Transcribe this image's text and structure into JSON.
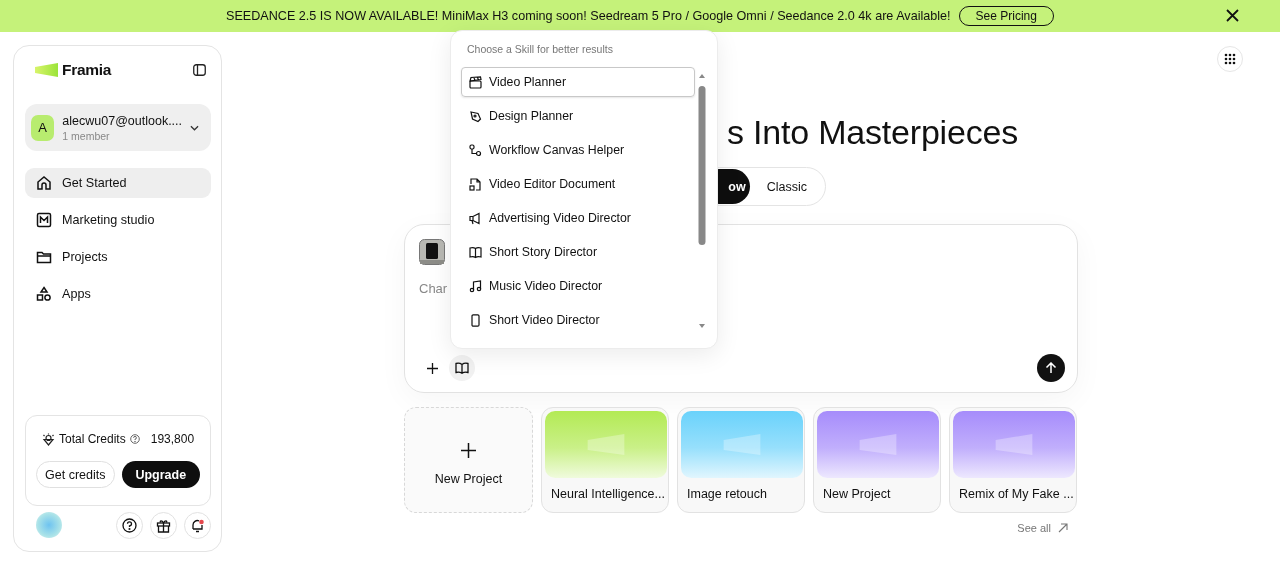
{
  "banner": {
    "message": "SEEDANCE 2.5 IS NOW AVAILABLE! MiniMax H3 coming soon! Seedream 5 Pro / Google Omni / Seedance 2.0 4k are Available!",
    "button": "See Pricing"
  },
  "sidebar": {
    "logo": "Framia",
    "account": {
      "avatar": "A",
      "name": "alecwu07@outlook....",
      "members": "1 member"
    },
    "nav": [
      {
        "label": "Get Started",
        "selected": true
      },
      {
        "label": "Marketing studio",
        "selected": false
      },
      {
        "label": "Projects",
        "selected": false
      },
      {
        "label": "Apps",
        "selected": false
      }
    ],
    "credits": {
      "label": "Total Credits",
      "value": "193,800",
      "secondary_button": "Get credits",
      "primary_button": "Upgrade"
    },
    "has_notification": true
  },
  "heading": "s Into Masterpieces",
  "mode_toggle": [
    {
      "label": "ow",
      "selected": true
    },
    {
      "label": "Classic",
      "selected": false
    }
  ],
  "prompt": {
    "placeholder": "Char"
  },
  "skill_menu": {
    "title": "Choose a Skill for better results",
    "items": [
      {
        "label": "Video Planner",
        "selected": true
      },
      {
        "label": "Design Planner",
        "selected": false
      },
      {
        "label": "Workflow Canvas Helper",
        "selected": false
      },
      {
        "label": "Video Editor Document",
        "selected": false
      },
      {
        "label": "Advertising Video Director",
        "selected": false
      },
      {
        "label": "Short Story Director",
        "selected": false
      },
      {
        "label": "Music Video Director",
        "selected": false
      },
      {
        "label": "Short Video Director",
        "selected": false
      }
    ]
  },
  "projects": [
    {
      "kind": "new",
      "title": "New Project"
    },
    {
      "kind": "project",
      "title": "Neural Intelligence...",
      "color": "#b3ea55"
    },
    {
      "kind": "project",
      "title": "Image retouch",
      "color": "#6ad2fb"
    },
    {
      "kind": "project",
      "title": "New Project",
      "color": "#a68cfb"
    },
    {
      "kind": "project",
      "title": "Remix of My Fake ...",
      "color": "#a68cfb"
    }
  ],
  "see_all": "See all"
}
